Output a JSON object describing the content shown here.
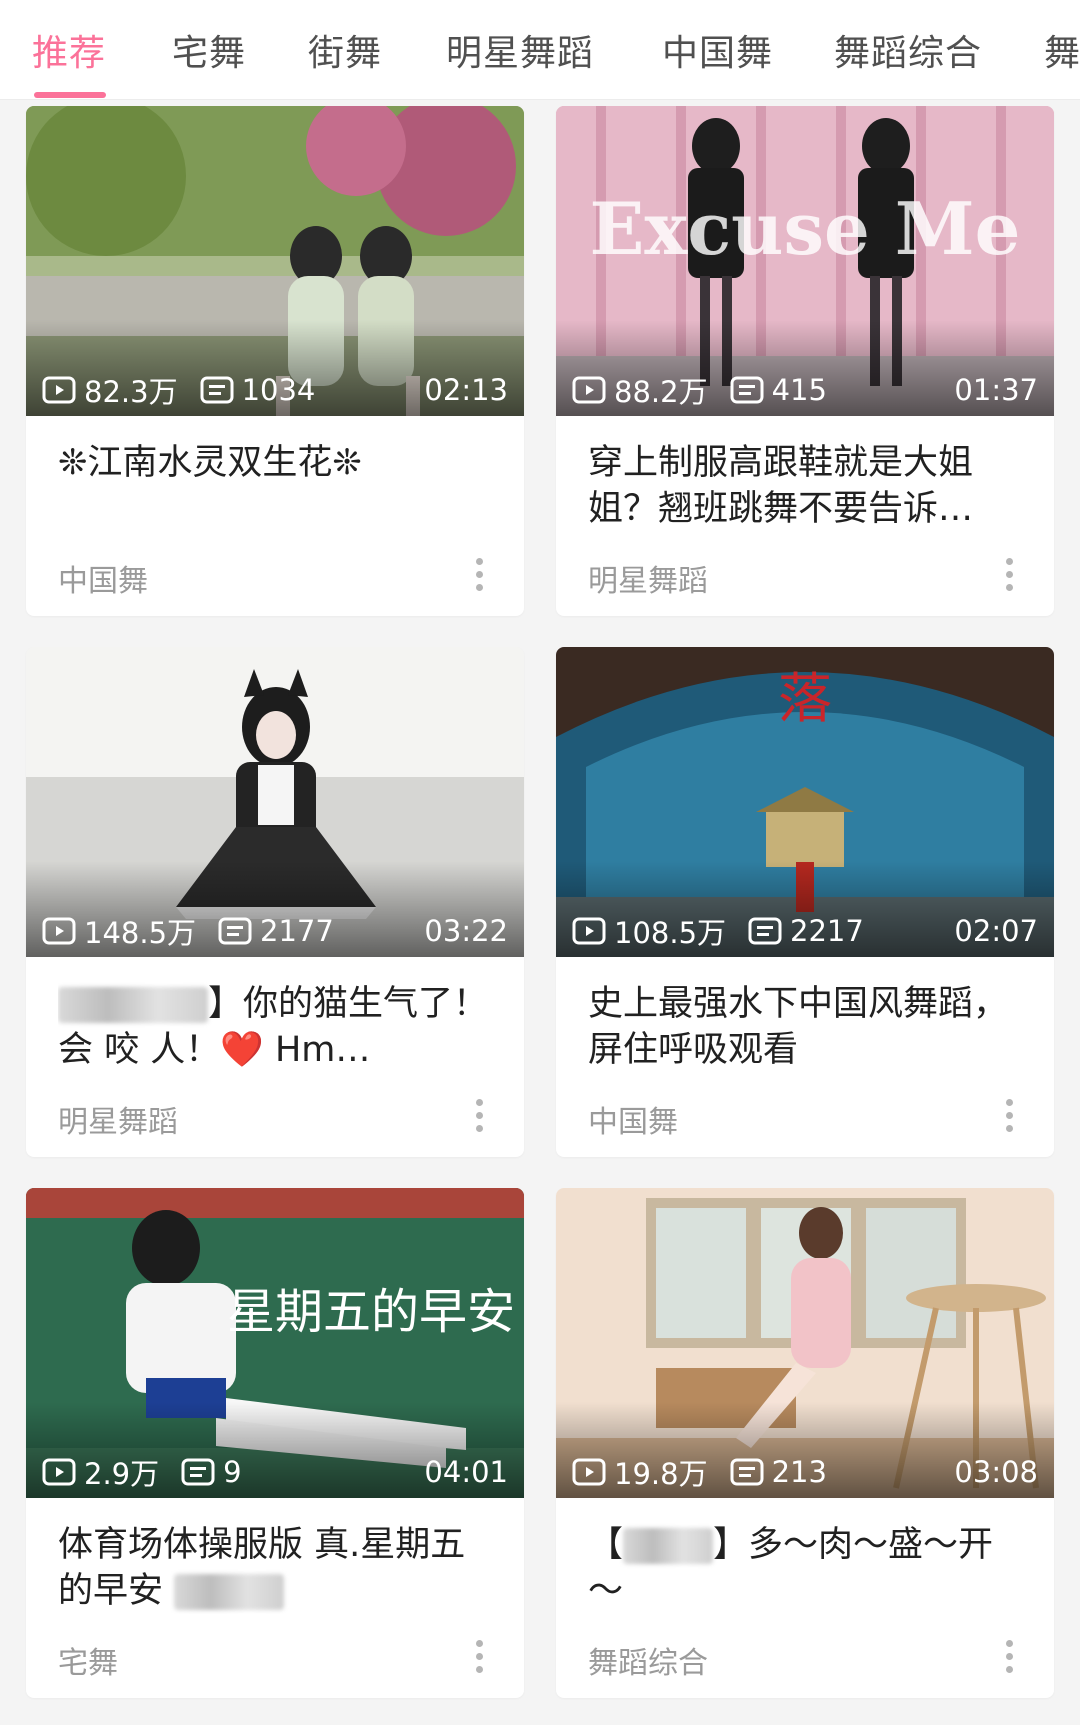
{
  "tabs": [
    "推荐",
    "宅舞",
    "街舞",
    "明星舞蹈",
    "中国舞",
    "舞蹈综合",
    "舞"
  ],
  "accent_color": "#fb7299",
  "cards": [
    {
      "views": "82.3万",
      "comments": "1034",
      "duration": "02:13",
      "title": "❊江南水灵双生花❊",
      "tag": "中国舞"
    },
    {
      "views": "88.2万",
      "comments": "415",
      "duration": "01:37",
      "title": "穿上制服高跟鞋就是大姐姐？翘班跳舞不要告诉…",
      "tag": "明星舞蹈",
      "overlay": "Excuse Me"
    },
    {
      "views": "148.5万",
      "comments": "2177",
      "duration": "03:22",
      "title_after": "】你的猫生气了！会 咬 人！❤️ Hm…",
      "tag": "明星舞蹈"
    },
    {
      "views": "108.5万",
      "comments": "2217",
      "duration": "02:07",
      "title": "史上最强水下中国风舞蹈，屏住呼吸观看",
      "tag": "中国舞",
      "overlay": "落"
    },
    {
      "views": "2.9万",
      "comments": "9",
      "duration": "04:01",
      "title": "体育场体操服版 真.星期五的早安",
      "tag": "宅舞",
      "overlay": "星期五的早安"
    },
    {
      "views": "19.8万",
      "comments": "213",
      "duration": "03:08",
      "title_before": "【",
      "title_after": "】多～肉～盛～开～",
      "tag": "舞蹈综合"
    }
  ],
  "icons": {
    "views": "play-count-icon",
    "comments": "danmaku-icon",
    "more": "more-vertical-icon"
  }
}
